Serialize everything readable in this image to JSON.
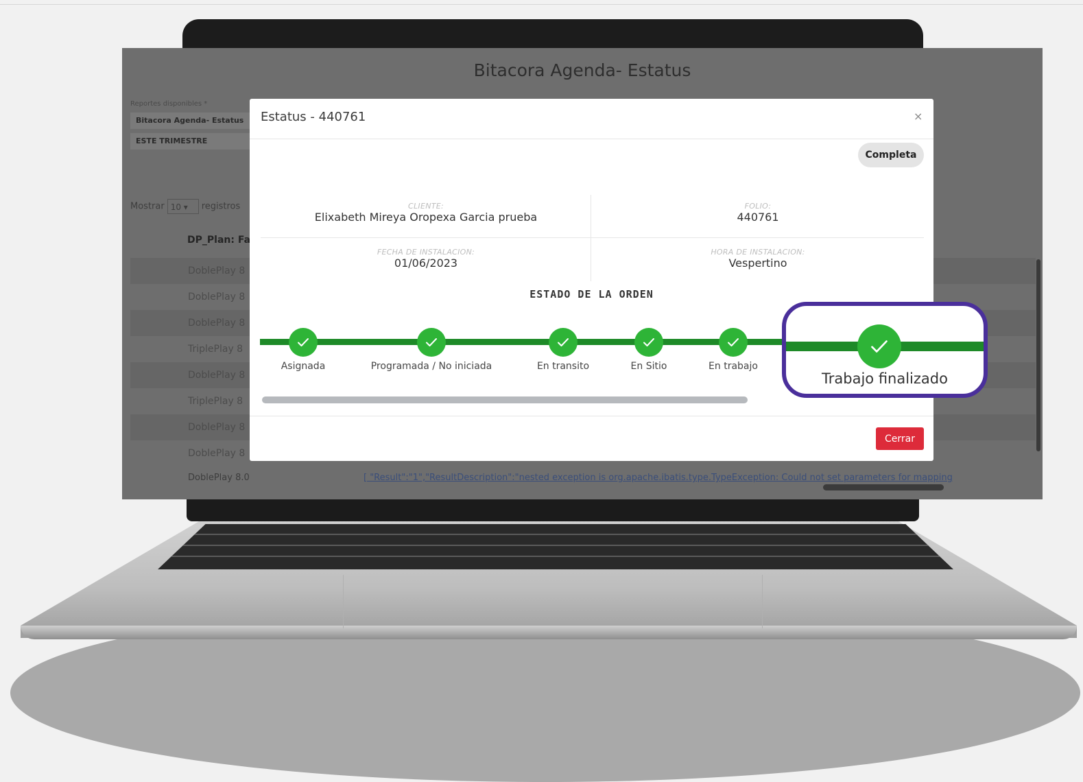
{
  "background_app": {
    "title": "Bitacora Agenda- Estatus",
    "reports_label": "Reportes disponibles *",
    "report_select_value": "Bitacora Agenda- Estatus",
    "period_select_value": "ESTE TRIMESTRE",
    "show_label": "Mostrar",
    "show_value": "10",
    "show_suffix": "registros",
    "column_header": "DP_Plan: Fa",
    "rows": [
      "DoblePlay 8",
      "DoblePlay 8",
      "DoblePlay 8",
      "TriplePlay 8",
      "DoblePlay 8",
      "TriplePlay 8",
      "DoblePlay 8",
      "DoblePlay 8"
    ],
    "last_row_plan": "DoblePlay 8.0",
    "last_row_result": "[ \"Result\":\"1\",\"ResultDescription\":\"nested exception is org.apache.ibatis.type.TypeException: Could not set parameters for mapping"
  },
  "modal": {
    "title": "Estatus - 440761",
    "close_symbol": "×",
    "status_badge": "Completa",
    "cliente_label": "CLIENTE:",
    "cliente_value": "Elixabeth Mireya Oropexa Garcia prueba",
    "folio_label": "FOLIO:",
    "folio_value": "440761",
    "fecha_label": "FECHA DE INSTALACION:",
    "fecha_value": "01/06/2023",
    "hora_label": "HORA DE INSTALACION:",
    "hora_value": "Vespertino",
    "estado_heading": "ESTADO DE LA ORDEN",
    "steps": [
      "Asignada",
      "Programada / No iniciada",
      "En transito",
      "En Sitio",
      "En trabajo",
      "Trabajo finalizado"
    ],
    "close_button": "Cerrar"
  },
  "colors": {
    "step_green": "#2eb437",
    "track_green": "#1e8a28",
    "highlight_purple": "#4a2f9b",
    "close_red": "#dd2b3a"
  },
  "icons": {
    "step": "check-icon",
    "close": "close-icon"
  }
}
